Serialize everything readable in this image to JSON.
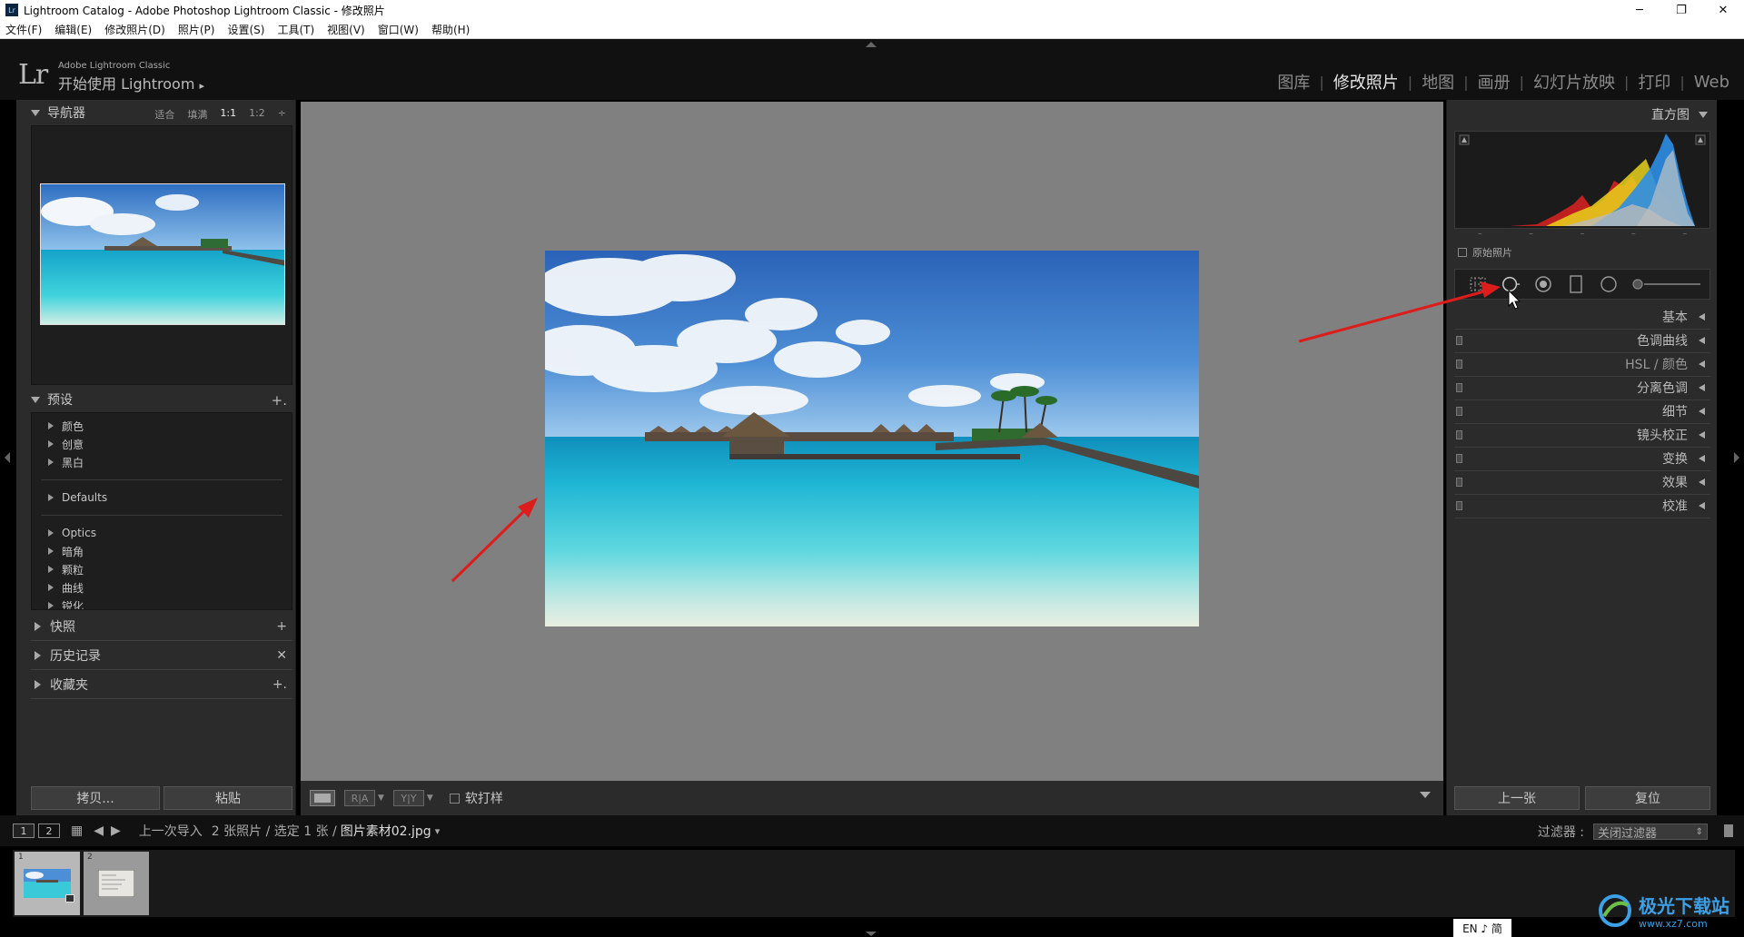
{
  "window": {
    "title": "Lightroom Catalog - Adobe Photoshop Lightroom Classic - 修改照片",
    "icon_text": "Lr",
    "minimize": "─",
    "maximize": "❐",
    "close": "✕"
  },
  "menu": [
    "文件(F)",
    "编辑(E)",
    "修改照片(D)",
    "照片(P)",
    "设置(S)",
    "工具(T)",
    "视图(V)",
    "窗口(W)",
    "帮助(H)"
  ],
  "header": {
    "logo": "Lr",
    "product": "Adobe Lightroom Classic",
    "identity": "开始使用 Lightroom",
    "identity_arrow": "▸",
    "modules": [
      "图库",
      "修改照片",
      "地图",
      "画册",
      "幻灯片放映",
      "打印",
      "Web"
    ],
    "active_module": "修改照片",
    "separator": "|"
  },
  "left_panel": {
    "navigator": {
      "title": "导航器",
      "zoom_options": [
        "适合",
        "填满",
        "1:1",
        "1:2"
      ],
      "active_zoom": "1:1",
      "zoom_more": "÷"
    },
    "presets": {
      "title": "预设",
      "add": "+.",
      "groups_a": [
        "颜色",
        "创意",
        "黑白"
      ],
      "groups_b": [
        "Defaults"
      ],
      "groups_c": [
        "Optics",
        "暗角",
        "颗粒",
        "曲线",
        "锐化"
      ]
    },
    "snapshots": {
      "title": "快照",
      "action": "+"
    },
    "history": {
      "title": "历史记录",
      "action": "✕"
    },
    "collections": {
      "title": "收藏夹",
      "action": "+."
    },
    "copy_button": "拷贝...",
    "paste_button": "粘贴"
  },
  "toolbar": {
    "ra_label": "R|A",
    "yy_label": "Y|Y",
    "softproof_label": "软打样"
  },
  "right_panel": {
    "histogram": {
      "title": "直方图",
      "ticks": [
        "–",
        "–",
        "–",
        "–",
        "–"
      ],
      "original_label": "原始照片"
    },
    "sections": [
      "基本",
      "色调曲线",
      "HSL / 颜色",
      "分离色调",
      "细节",
      "镜头校正",
      "变换",
      "效果",
      "校准"
    ],
    "prev_button": "上一张",
    "reset_button": "复位"
  },
  "filmstrip_bar": {
    "page1": "1",
    "page2": "2",
    "source": "上一次导入",
    "count": "2 张照片 / 选定 1 张 /",
    "filename": "图片素材02.jpg",
    "filename_caret": "▾",
    "filter_label": "过滤器 :",
    "filter_value": "关闭过滤器",
    "filter_caret": "⇕"
  },
  "filmstrip": {
    "thumb1_index": "1",
    "thumb2_index": "2"
  },
  "ime": "EN ♪ 简",
  "watermark": {
    "big": "极光下载站",
    "small": "www.xz7.com"
  },
  "colors": {
    "accent_arrow": "#e02020",
    "panel": "#2b2b2b",
    "center_bg": "#808080"
  }
}
